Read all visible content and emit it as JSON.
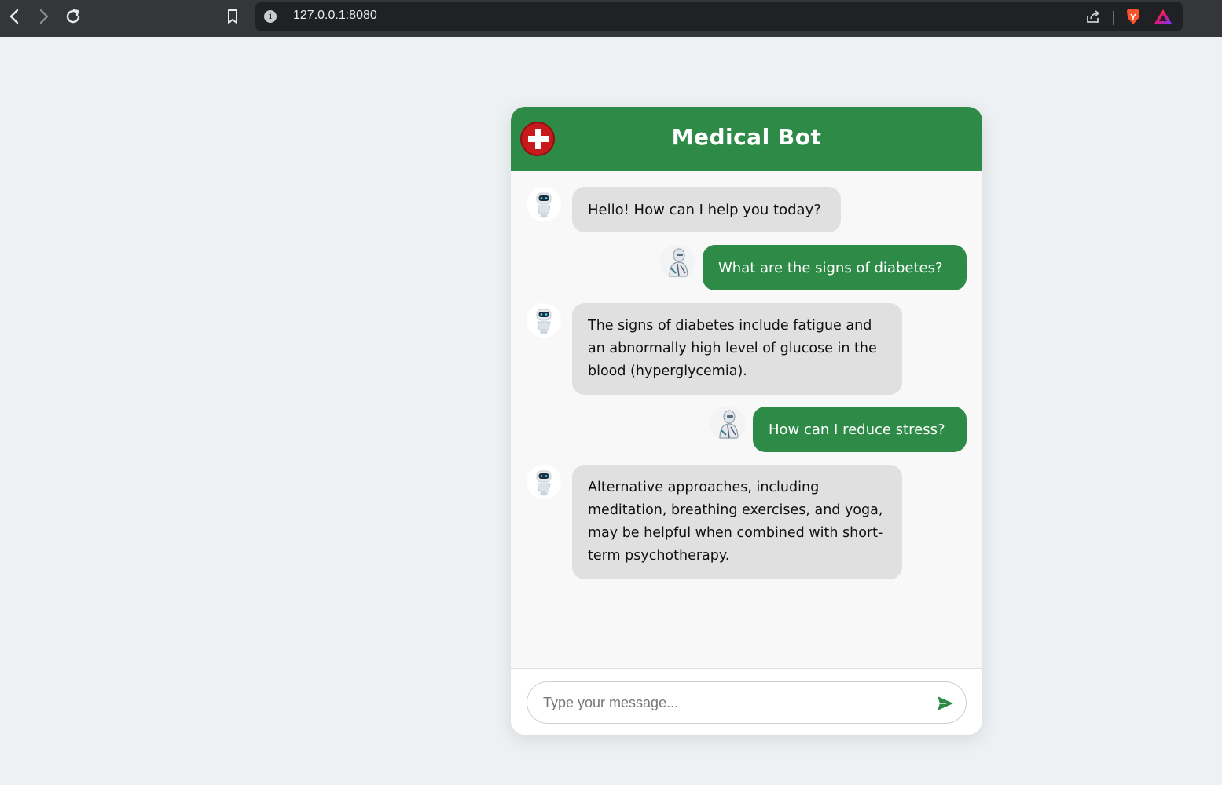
{
  "browser": {
    "back_icon": "chevron-left-icon",
    "forward_icon": "chevron-right-icon",
    "reload_icon": "reload-icon",
    "url": "127.0.0.1:8080"
  },
  "chat": {
    "title": "Medical Bot",
    "colors": {
      "accent": "#2e8b47",
      "bot_bubble": "#e0e0e0",
      "logo": "#c8191d"
    },
    "messages": [
      {
        "sender": "bot",
        "text": "Hello! How can I help you today?"
      },
      {
        "sender": "user",
        "text": "What are the signs of diabetes?"
      },
      {
        "sender": "bot",
        "text": "The signs of diabetes include fatigue and an abnormally high level of glucose in the blood (hyperglycemia)."
      },
      {
        "sender": "user",
        "text": "How can I reduce stress?"
      },
      {
        "sender": "bot",
        "text": "Alternative approaches, including meditation, breathing exercises, and yoga, may be helpful when combined with short-term psychotherapy."
      }
    ],
    "input_placeholder": "Type your message..."
  }
}
